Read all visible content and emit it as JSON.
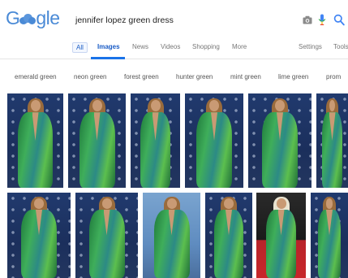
{
  "search": {
    "query": "jennifer lopez green dress"
  },
  "logo": {
    "letters": [
      "G",
      "",
      "gle"
    ],
    "colors": [
      "#4a8ad6",
      "#d9463c",
      "#4a8ad6"
    ]
  },
  "icons": [
    "camera-icon",
    "mic-icon",
    "search-icon",
    "cloud-doodle"
  ],
  "tabs": [
    {
      "label": "All",
      "key": "all",
      "active": false
    },
    {
      "label": "Images",
      "key": "images",
      "active": true
    },
    {
      "label": "News",
      "key": "news",
      "active": false
    },
    {
      "label": "Videos",
      "key": "videos",
      "active": false
    },
    {
      "label": "Shopping",
      "key": "shopping",
      "active": false
    },
    {
      "label": "More",
      "key": "more",
      "active": false
    },
    {
      "label": "Settings",
      "key": "settings",
      "active": false
    },
    {
      "label": "Tools",
      "key": "tools",
      "active": false
    }
  ],
  "related_searches": [
    "emerald green",
    "neon green",
    "forest green",
    "hunter green",
    "mint green",
    "lime green",
    "prom"
  ],
  "colors": {
    "accent_blue": "#1a73e8",
    "dress_green": "#2f9a4f",
    "backdrop_navy": "#1f3566",
    "red_carpet": "#c8262a"
  },
  "images": [
    {
      "name": "result-image-1",
      "bg": "navy"
    },
    {
      "name": "result-image-2",
      "bg": "navy"
    },
    {
      "name": "result-image-3",
      "bg": "navy"
    },
    {
      "name": "result-image-4",
      "bg": "navy"
    },
    {
      "name": "result-image-5",
      "bg": "navy"
    },
    {
      "name": "result-image-6",
      "bg": "navy"
    },
    {
      "name": "result-image-7",
      "bg": "navy"
    },
    {
      "name": "result-image-8",
      "bg": "navy"
    },
    {
      "name": "result-image-9",
      "bg": "blue"
    },
    {
      "name": "result-image-10",
      "bg": "navy"
    },
    {
      "name": "result-image-11",
      "bg": "red"
    },
    {
      "name": "result-image-12",
      "bg": "navy"
    }
  ]
}
